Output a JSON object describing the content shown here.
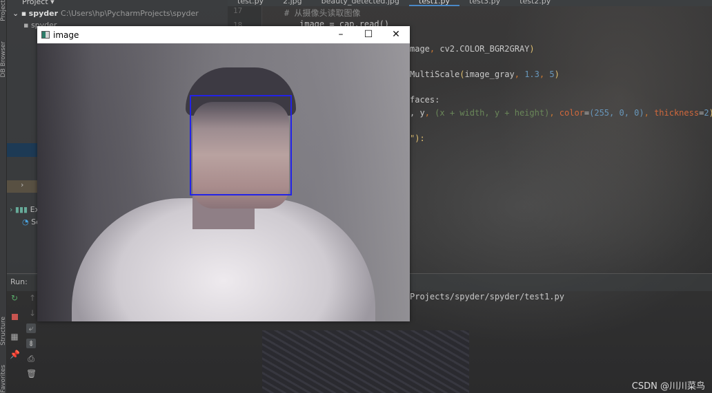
{
  "ide": {
    "project_header": "Project",
    "tool_strip": {
      "project_label": "Project",
      "db_browser_label": "DB Browser",
      "structure_label": "Structure",
      "favorites_label": "Favorites"
    },
    "tree": {
      "root_name": "spyder",
      "root_path": "C:\\Users\\hp\\PycharmProjects\\spyder",
      "child": "spyder",
      "ext_label": "Ex",
      "scratch_label": "Sc"
    },
    "tabs": [
      {
        "label": "test.py"
      },
      {
        "label": "2.jpg"
      },
      {
        "label": "beauty_detected.jpg"
      },
      {
        "label": "test1.py",
        "active": true
      },
      {
        "label": "test3.py"
      },
      {
        "label": "test2.py"
      }
    ],
    "line_numbers": [
      "17",
      "18"
    ],
    "code": {
      "l17": "# 从摄像头读取图像",
      "l18": "image = cap.read()",
      "l_gray_a": "mage",
      "l_gray_b": ", ",
      "l_gray_c": "cv2.COLOR_BGR2GRAY",
      "l_detect_a": "MultiScale",
      "l_detect_b": "image_gray",
      "l_detect_c": "1.3",
      "l_detect_d": "5",
      "l_faces": "faces:",
      "l_rect_a": ", y",
      "l_rect_b": "(x + width, y + height)",
      "l_rect_c": "color",
      "l_rect_d": "(255, 0, 0)",
      "l_rect_e": "thickness",
      "l_rect_f": "2",
      "l_end": "\"):"
    },
    "run": {
      "label": "Run:",
      "console_line": "Projects/spyder/spyder/test1.py"
    }
  },
  "image_window": {
    "title": "image",
    "minimize": "–",
    "maximize": "☐",
    "close": "✕",
    "face_box_color": "#2222e8"
  },
  "watermark": "CSDN @川川菜鸟",
  "colors": {
    "accent": "#4a88c7",
    "stop": "#c75450",
    "rerun": "#59a869"
  }
}
